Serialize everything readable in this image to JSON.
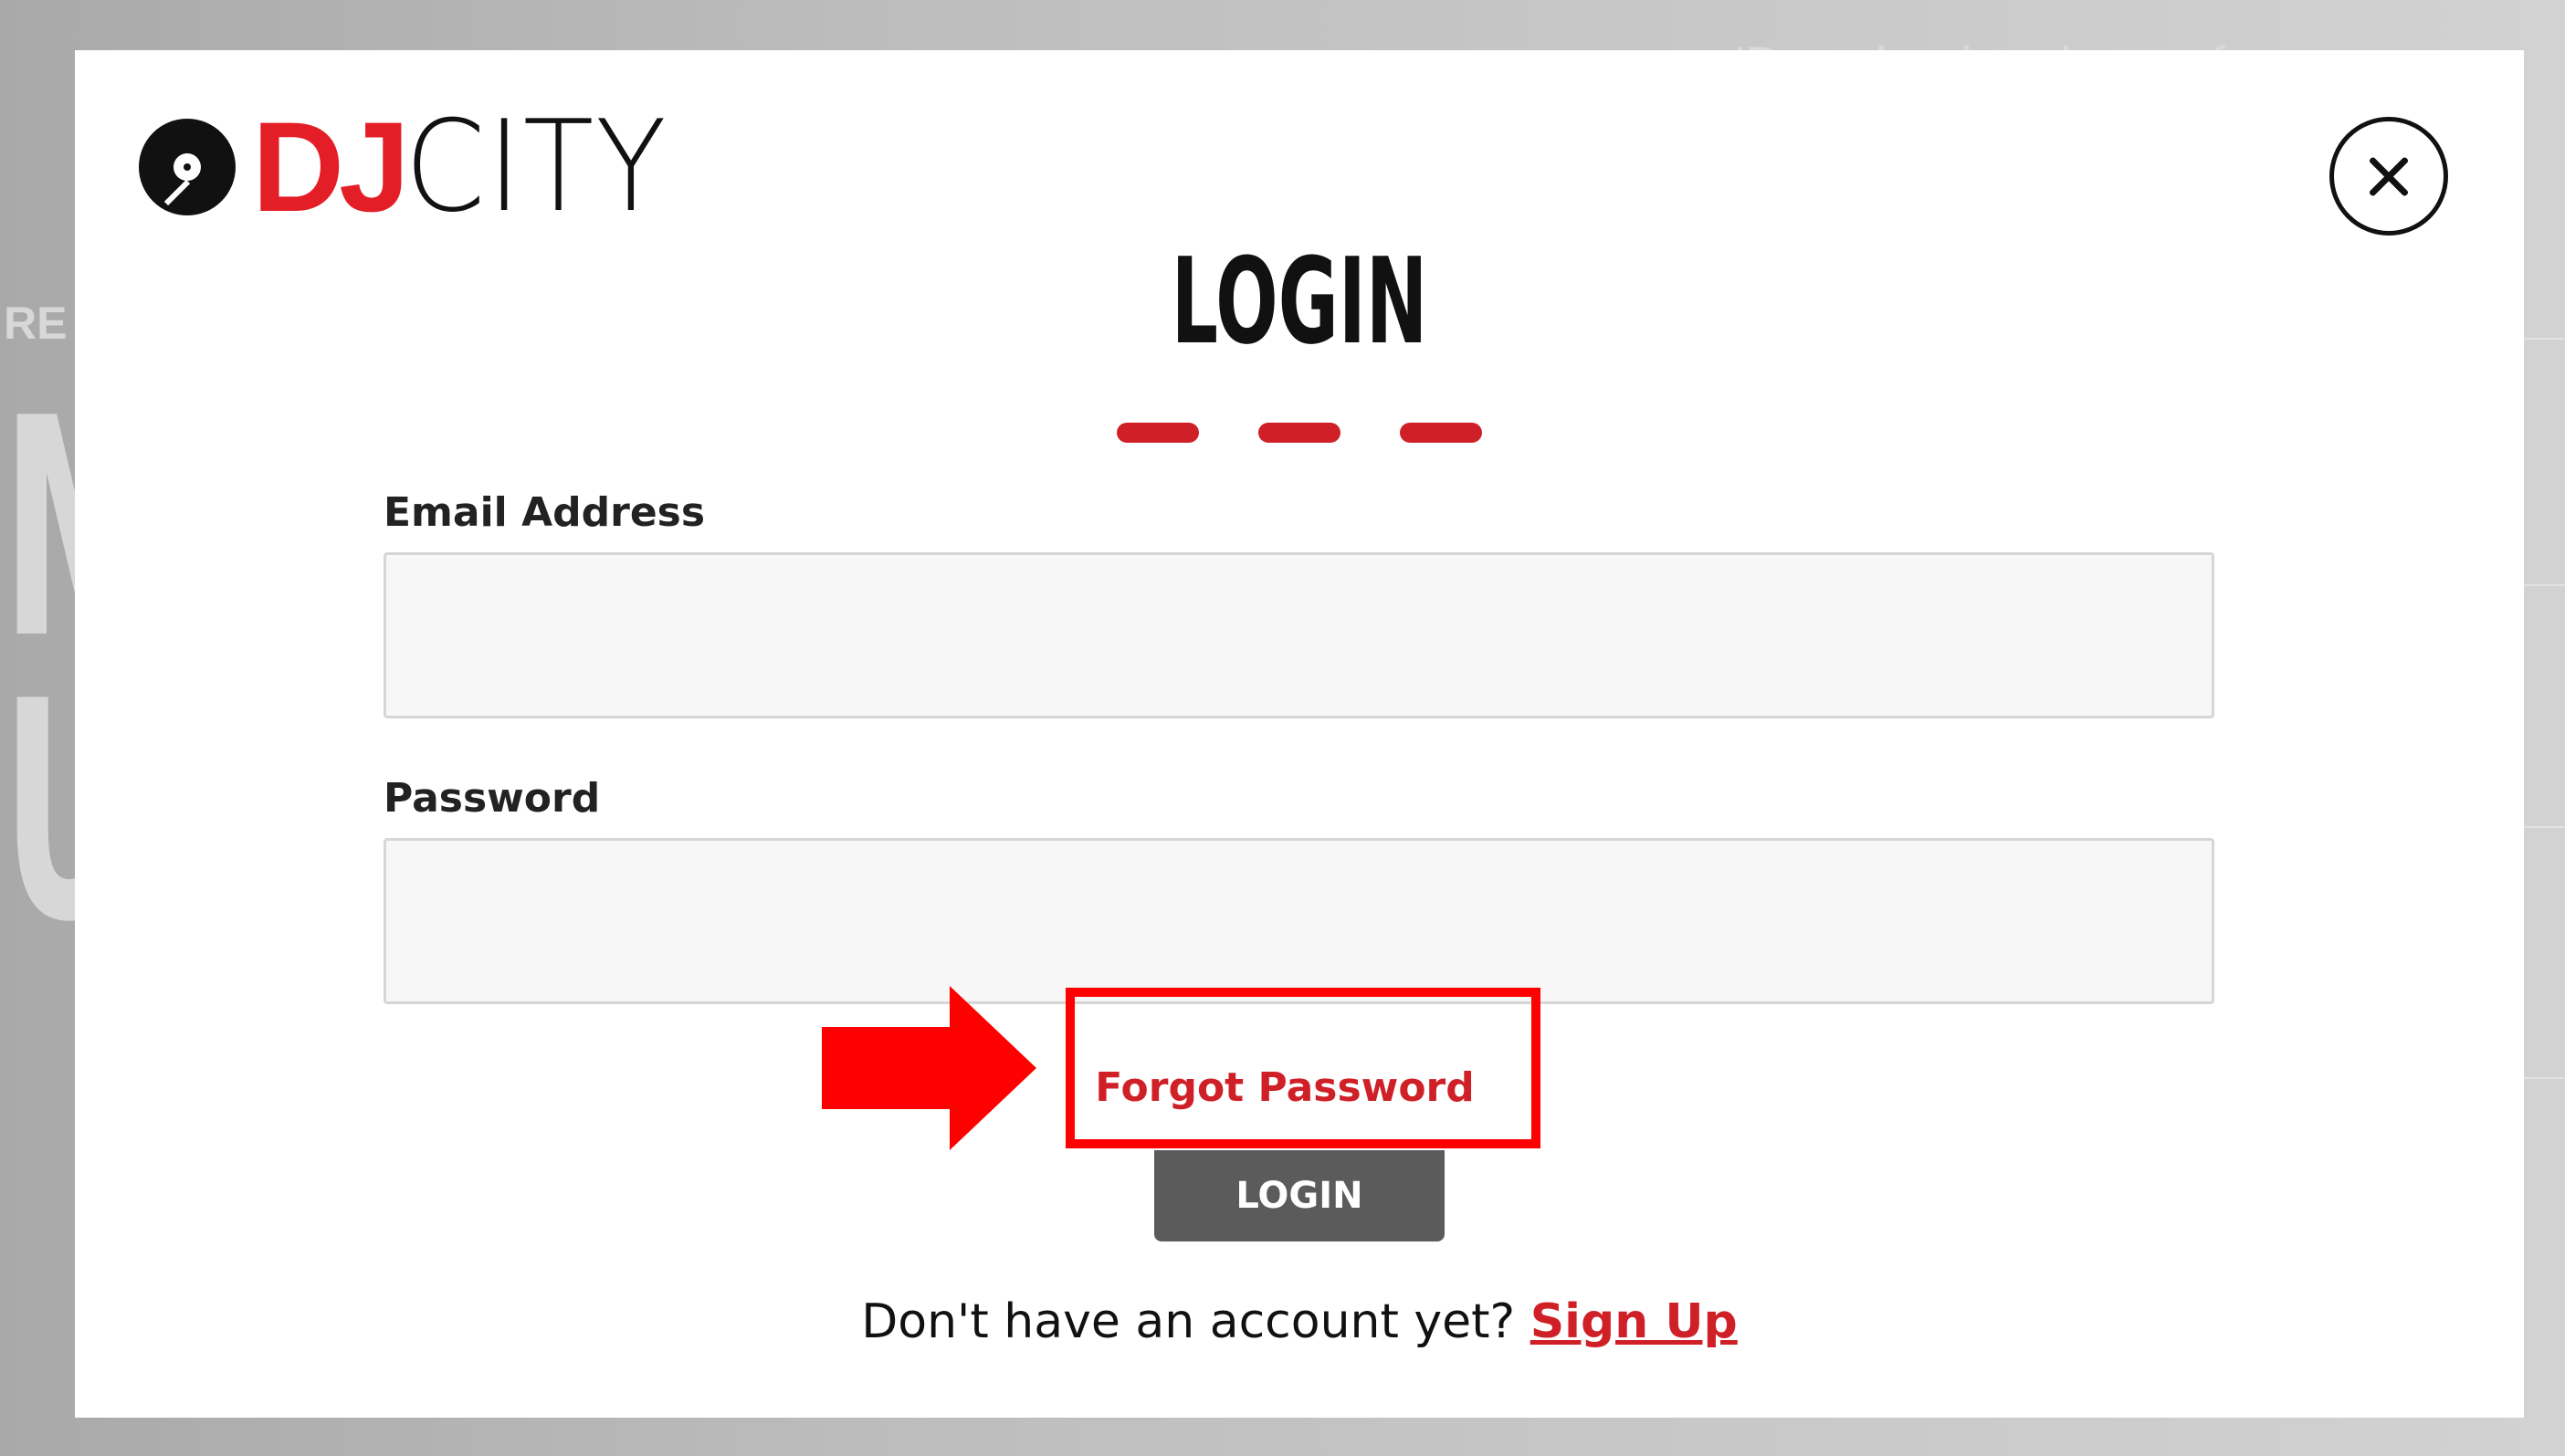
{
  "background": {
    "tagline": "'Download and use of our …",
    "partial_small": "RE I",
    "partial_big_1": "M",
    "partial_big_2": "U"
  },
  "logo": {
    "brand_part_1": "DJ",
    "brand_part_2": "CITY"
  },
  "modal": {
    "title": "LOGIN",
    "email": {
      "label": "Email Address",
      "value": "",
      "placeholder": ""
    },
    "password": {
      "label": "Password",
      "value": "",
      "placeholder": ""
    },
    "forgot_password_label": "Forgot Password",
    "login_button_label": "LOGIN",
    "signup_prompt": "Don't have an account yet?",
    "signup_link_label": "Sign Up",
    "close_icon": "close-x-icon"
  },
  "colors": {
    "brand_red": "#cf2027",
    "logo_red": "#e41e26",
    "annotation_red": "#ff0000",
    "button_gray": "#5b5b5b"
  }
}
